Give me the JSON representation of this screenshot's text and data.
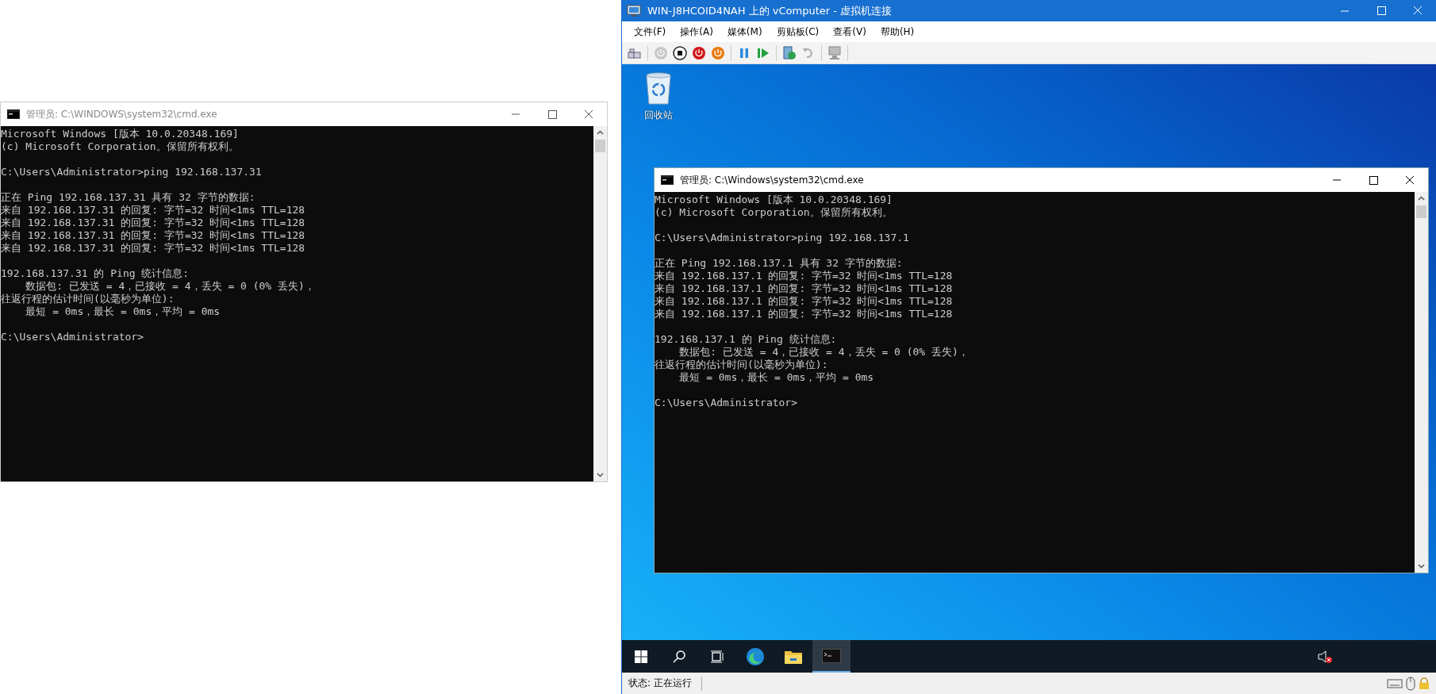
{
  "host_console": {
    "title": "管理员: C:\\WINDOWS\\system32\\cmd.exe",
    "active": false,
    "paragraphs": [
      [
        "Microsoft Windows [版本 10.0.20348.169]",
        "(c) Microsoft Corporation。保留所有权利。"
      ],
      [
        "C:\\Users\\Administrator>ping 192.168.137.31"
      ],
      [
        "正在 Ping 192.168.137.31 具有 32 字节的数据:",
        "来自 192.168.137.31 的回复: 字节=32 时间<1ms TTL=128",
        "来自 192.168.137.31 的回复: 字节=32 时间<1ms TTL=128",
        "来自 192.168.137.31 的回复: 字节=32 时间<1ms TTL=128",
        "来自 192.168.137.31 的回复: 字节=32 时间<1ms TTL=128"
      ],
      [
        "192.168.137.31 的 Ping 统计信息:",
        "    数据包: 已发送 = 4，已接收 = 4，丢失 = 0 (0% 丢失)，",
        "往返行程的估计时间(以毫秒为单位):",
        "    最短 = 0ms，最长 = 0ms，平均 = 0ms"
      ],
      [
        "C:\\Users\\Administrator>"
      ]
    ]
  },
  "vm_window": {
    "title": "WIN-J8HCOID4NAH 上的 vComputer - 虚拟机连接",
    "menu": [
      "文件(F)",
      "操作(A)",
      "媒体(M)",
      "剪贴板(C)",
      "查看(V)",
      "帮助(H)"
    ],
    "desktop_icons": [
      {
        "label": "回收站"
      }
    ],
    "guest_console": {
      "title": "管理员: C:\\Windows\\system32\\cmd.exe",
      "active": true,
      "paragraphs": [
        [
          "Microsoft Windows [版本 10.0.20348.169]",
          "(c) Microsoft Corporation。保留所有权利。"
        ],
        [
          "C:\\Users\\Administrator>ping 192.168.137.1"
        ],
        [
          "正在 Ping 192.168.137.1 具有 32 字节的数据:",
          "来自 192.168.137.1 的回复: 字节=32 时间<1ms TTL=128",
          "来自 192.168.137.1 的回复: 字节=32 时间<1ms TTL=128",
          "来自 192.168.137.1 的回复: 字节=32 时间<1ms TTL=128",
          "来自 192.168.137.1 的回复: 字节=32 时间<1ms TTL=128"
        ],
        [
          "192.168.137.1 的 Ping 统计信息:",
          "    数据包: 已发送 = 4，已接收 = 4，丢失 = 0 (0% 丢失)，",
          "往返行程的估计时间(以毫秒为单位):",
          "    最短 = 0ms，最长 = 0ms，平均 = 0ms"
        ],
        [
          "C:\\Users\\Administrator>"
        ]
      ]
    },
    "taskbar": [
      {
        "kind": "start",
        "selected": false
      },
      {
        "kind": "search",
        "selected": false
      },
      {
        "kind": "taskview",
        "selected": false
      },
      {
        "kind": "browser",
        "selected": false
      },
      {
        "kind": "explorer",
        "selected": false
      },
      {
        "kind": "terminal",
        "selected": true
      }
    ],
    "status": "状态: 正在运行"
  }
}
